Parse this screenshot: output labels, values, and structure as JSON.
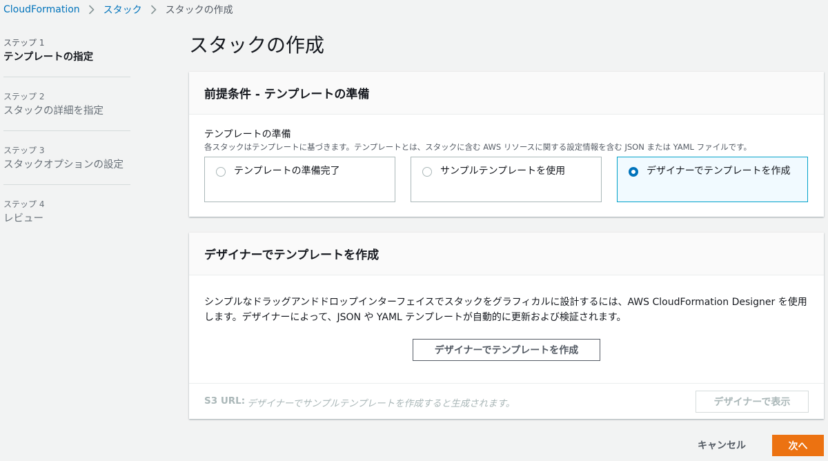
{
  "breadcrumb": {
    "items": [
      "CloudFormation",
      "スタック"
    ],
    "current": "スタックの作成"
  },
  "sidebar": {
    "steps": [
      {
        "num": "ステップ 1",
        "title": "テンプレートの指定",
        "active": true
      },
      {
        "num": "ステップ 2",
        "title": "スタックの詳細を指定",
        "active": false
      },
      {
        "num": "ステップ 3",
        "title": "スタックオプションの設定",
        "active": false
      },
      {
        "num": "ステップ 4",
        "title": "レビュー",
        "active": false
      }
    ]
  },
  "main": {
    "title": "スタックの作成",
    "prep_panel": {
      "header": "前提条件 - テンプレートの準備",
      "label": "テンプレートの準備",
      "description": "各スタックはテンプレートに基づきます。テンプレートとは、スタックに含む AWS リソースに関する設定情報を含む JSON または YAML ファイルです。",
      "options": [
        {
          "label": "テンプレートの準備完了",
          "selected": false
        },
        {
          "label": "サンプルテンプレートを使用",
          "selected": false
        },
        {
          "label": "デザイナーでテンプレートを作成",
          "selected": true
        }
      ]
    },
    "designer_panel": {
      "header": "デザイナーでテンプレートを作成",
      "body": "シンプルなドラッグアンドドロップインターフェイスでスタックをグラフィカルに設計するには、AWS CloudFormation Designer を使用します。デザイナーによって、JSON や YAML テンプレートが自動的に更新および検証されます。",
      "button": "デザイナーでテンプレートを作成",
      "s3_label": "S3 URL:",
      "s3_value": "デザイナーでサンプルテンプレートを作成すると生成されます。",
      "view_button": "デザイナーで表示"
    }
  },
  "footer": {
    "cancel": "キャンセル",
    "next": "次へ"
  },
  "colors": {
    "link": "#0073bb",
    "primary_button": "#ec7211",
    "selected_border": "#00a1c9",
    "selected_bg": "#f1faff"
  }
}
